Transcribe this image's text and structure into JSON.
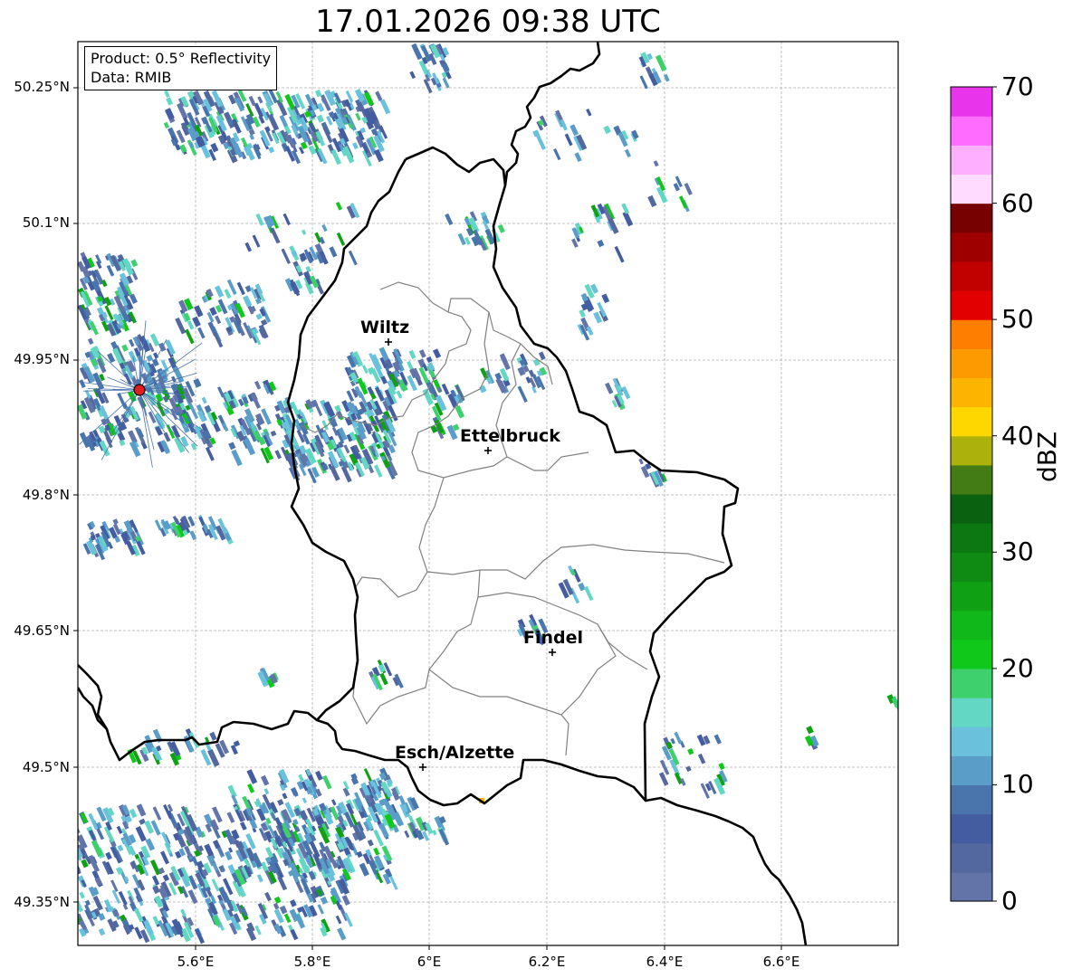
{
  "title": "17.01.2026 09:38 UTC",
  "info_box": {
    "product": "Product: 0.5° Reflectivity",
    "data_source": "Data: RMIB"
  },
  "y_axis_labels": [
    "50.25°N",
    "50.1°N",
    "49.95°N",
    "49.8°N",
    "49.65°N",
    "49.5°N",
    "49.35°N"
  ],
  "x_axis_labels": [
    "5.6°E",
    "5.8°E",
    "6°E",
    "6.2°E",
    "6.4°E",
    "6.6°E"
  ],
  "cities": [
    {
      "name": "Wiltz"
    },
    {
      "name": "Ettelbruck"
    },
    {
      "name": "Findel"
    },
    {
      "name": "Esch/Alzette"
    }
  ],
  "colorbar": {
    "label": "dBZ",
    "ticks": [
      "0",
      "10",
      "20",
      "30",
      "40",
      "50",
      "60",
      "70"
    ],
    "colors": [
      "#6274a8",
      "#53689e",
      "#445da0",
      "#4a74ac",
      "#5a9dc8",
      "#69c1dc",
      "#63d6c4",
      "#3ed06c",
      "#10c81a",
      "#10b81a",
      "#10a014",
      "#0f8a13",
      "#0c7812",
      "#0a6210",
      "#437b15",
      "#adb10c",
      "#fed701",
      "#fcb401",
      "#fd9901",
      "#fd7e01",
      "#e30000",
      "#c10000",
      "#9e0000",
      "#770000",
      "#ffdcff",
      "#ffafff",
      "#ff6cff",
      "#e835eb"
    ]
  }
}
